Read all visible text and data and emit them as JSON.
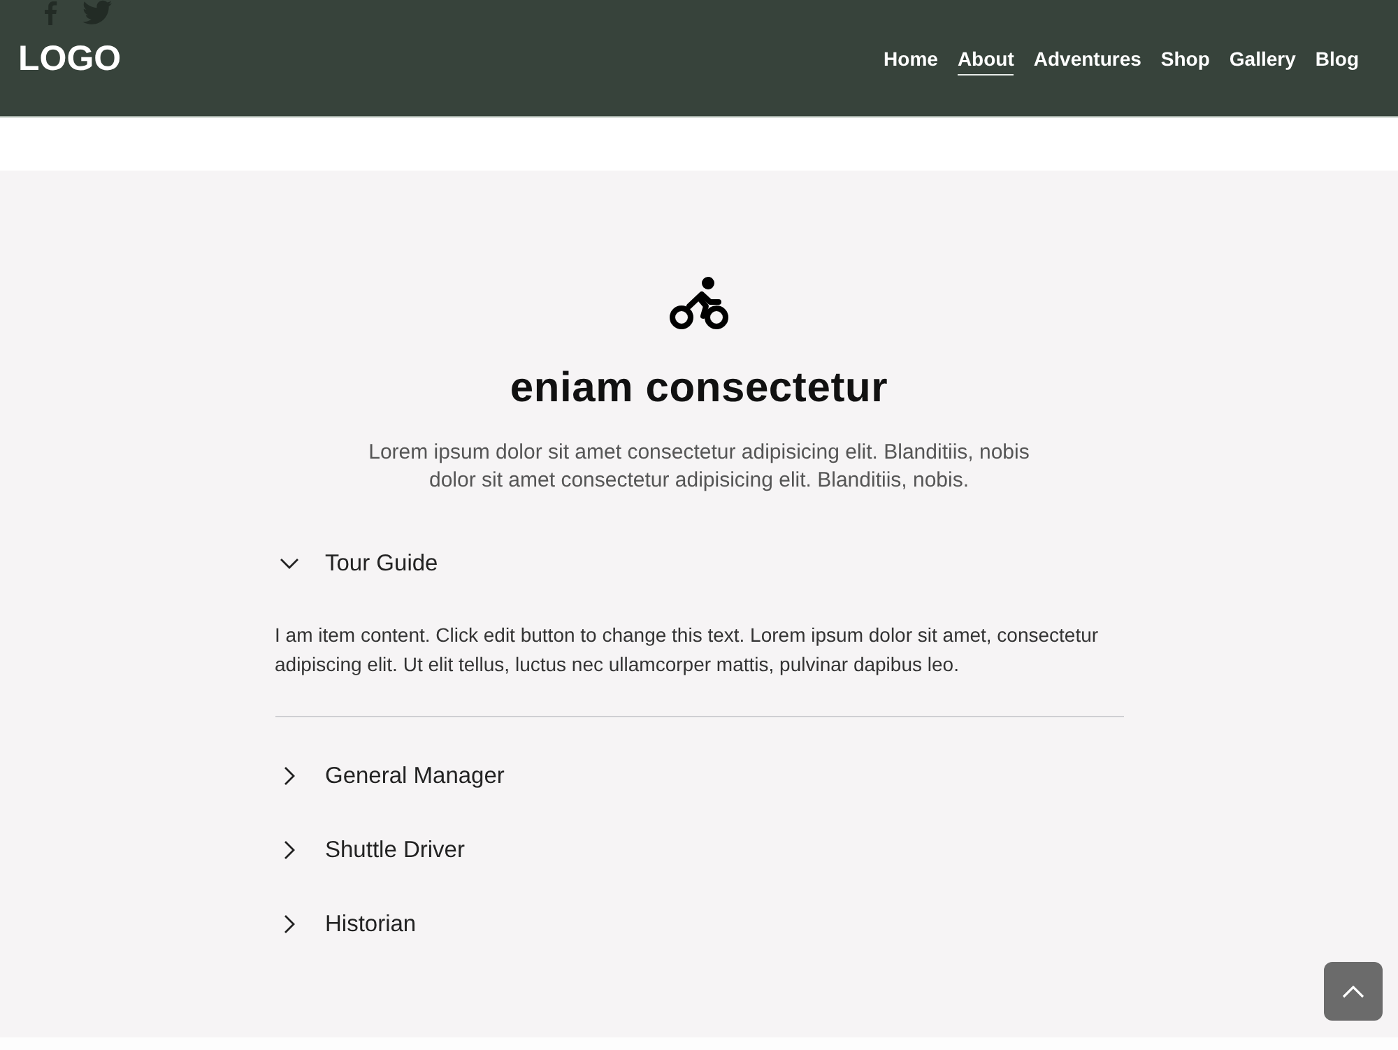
{
  "header": {
    "logo": "LOGO",
    "nav": [
      {
        "label": "Home",
        "selected": false
      },
      {
        "label": "About",
        "selected": true
      },
      {
        "label": "Adventures",
        "selected": false
      },
      {
        "label": "Shop",
        "selected": false
      },
      {
        "label": "Gallery",
        "selected": false
      },
      {
        "label": "Blog",
        "selected": false
      }
    ]
  },
  "section": {
    "title": "eniam consectetur",
    "intro": "Lorem ipsum dolor sit amet consectetur adipisicing elit. Blanditiis, nobis dolor sit amet consectetur adipisicing elit. Blanditiis, nobis.",
    "accordion": [
      {
        "title": "Tour Guide",
        "expanded": true,
        "content": "I am item content. Click edit button to change this text. Lorem ipsum dolor sit amet, consectetur adipiscing elit. Ut elit tellus, luctus nec ullamcorper mattis, pulvinar dapibus leo."
      },
      {
        "title": "General Manager",
        "expanded": false
      },
      {
        "title": "Shuttle Driver",
        "expanded": false
      },
      {
        "title": "Historian",
        "expanded": false
      }
    ]
  }
}
